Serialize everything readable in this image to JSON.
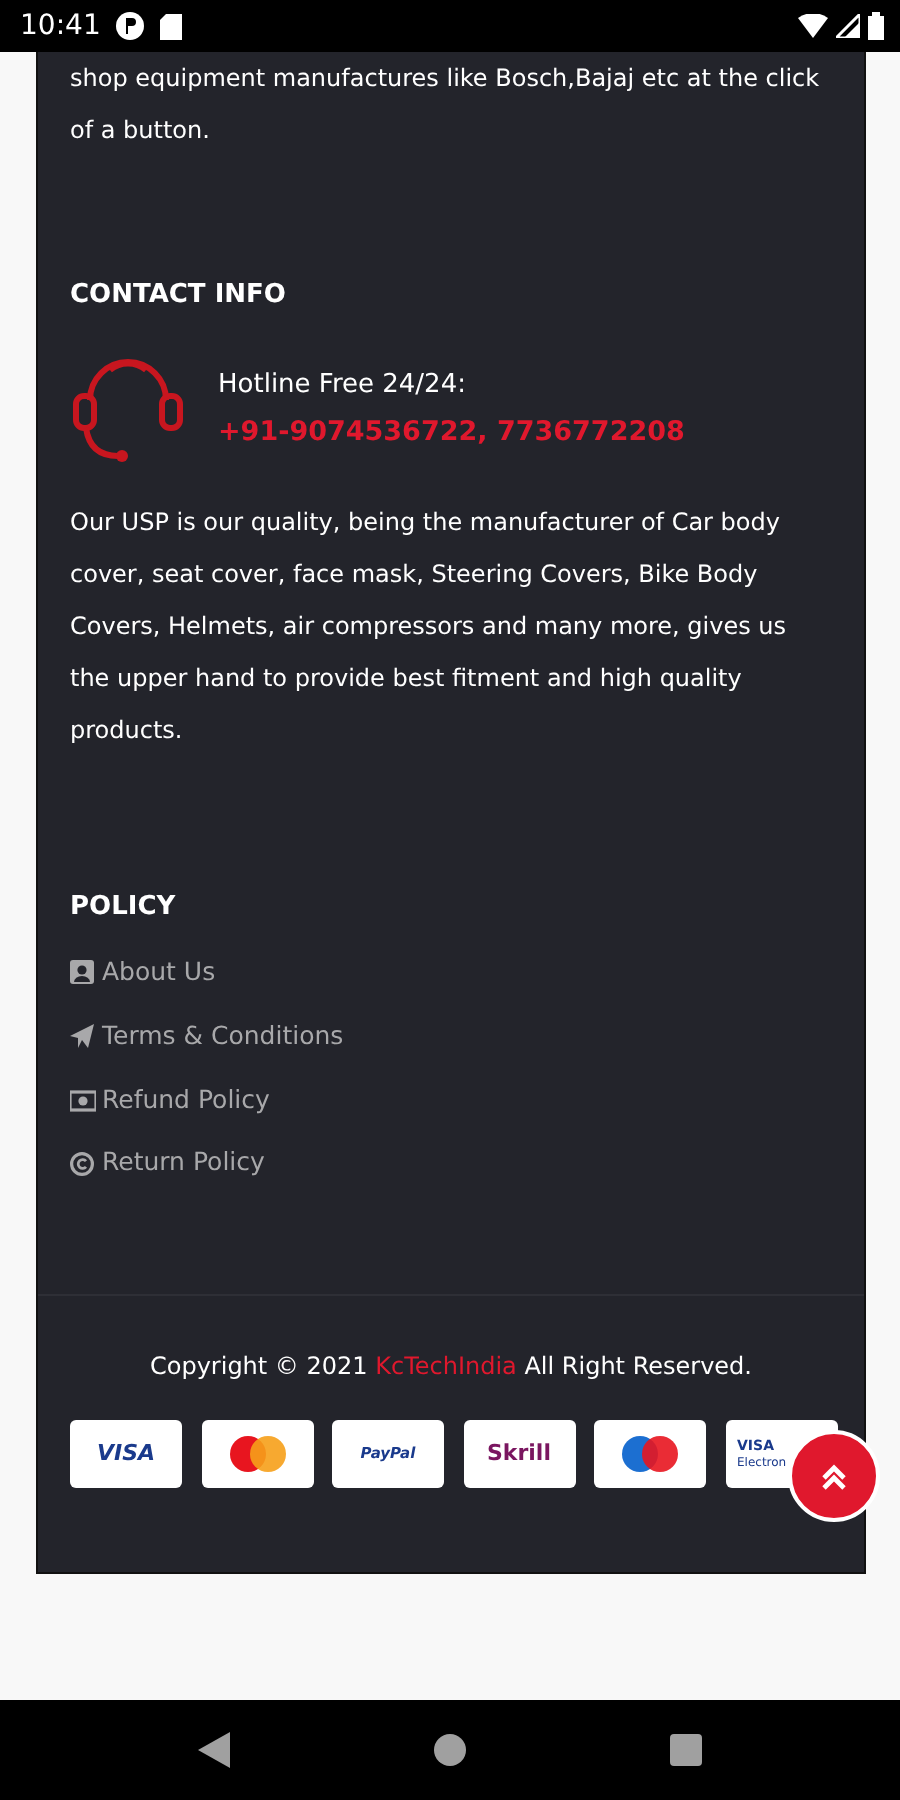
{
  "status_bar": {
    "time": "10:41"
  },
  "intro_text": "shop equipment manufactures like Bosch,Bajaj etc at the click of a button.",
  "contact": {
    "heading": "CONTACT INFO",
    "hotline_label": "Hotline Free 24/24:",
    "phone": "+91-9074536722, 7736772208",
    "description": "Our USP is our quality, being the manufacturer of Car body cover, seat cover, face mask, Steering Covers, Bike Body Covers, Helmets, air compressors and many more, gives us the upper hand to provide best fitment and high quality products."
  },
  "policy": {
    "heading": "POLICY",
    "links": [
      {
        "kind": "person",
        "label": "About Us"
      },
      {
        "kind": "plane",
        "label": "Terms & Conditions"
      },
      {
        "kind": "money",
        "label": "Refund Policy"
      },
      {
        "kind": "copyright",
        "label": "Return Policy"
      }
    ]
  },
  "footer": {
    "copyright_before": "Copyright © 2021",
    "brand": "KcTechIndia",
    "copyright_after": "All Right Reserved."
  },
  "payment_cards": [
    {
      "kind": "visa",
      "label": "VISA"
    },
    {
      "kind": "mastercard"
    },
    {
      "kind": "paypal",
      "label": "PayPal"
    },
    {
      "kind": "skrill",
      "label": "Skrill"
    },
    {
      "kind": "maestro"
    },
    {
      "kind": "electron",
      "label": "VISA",
      "sublabel": "Electron"
    }
  ]
}
